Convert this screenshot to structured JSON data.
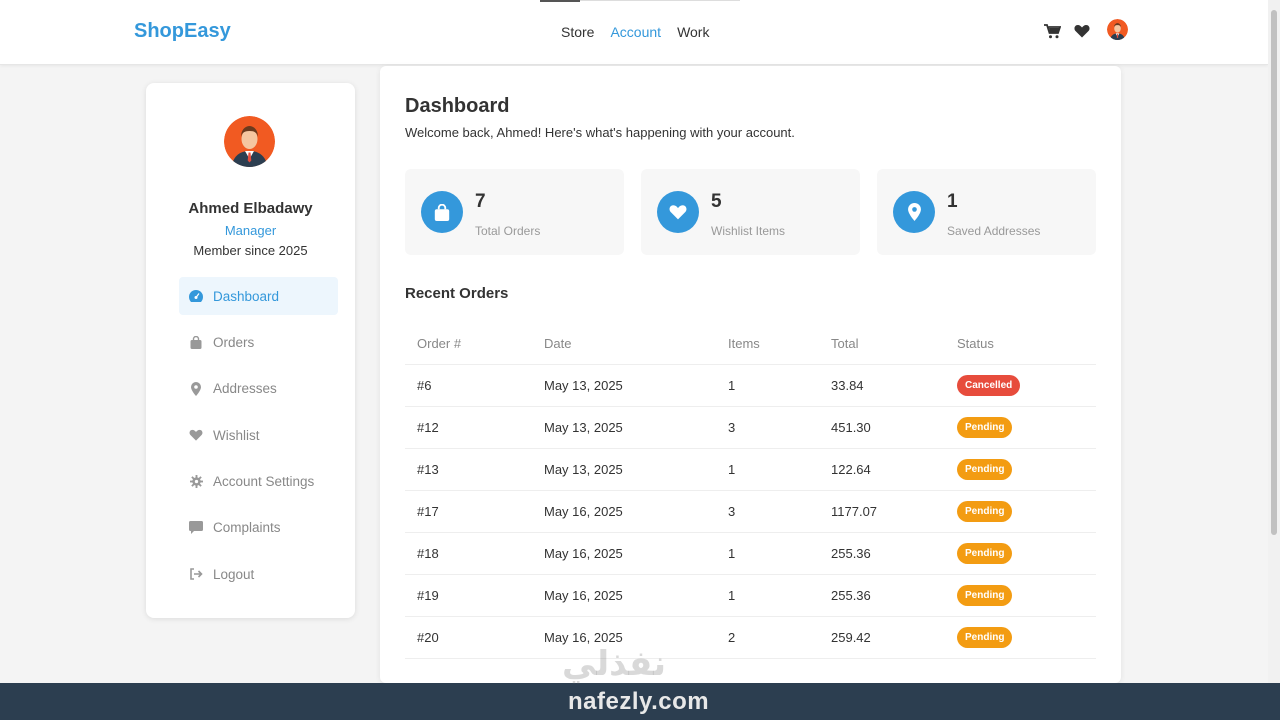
{
  "app": {
    "brand": "ShopEasy"
  },
  "nav": {
    "links": [
      {
        "label": "Store",
        "active": false
      },
      {
        "label": "Account",
        "active": true
      },
      {
        "label": "Work",
        "active": false
      }
    ],
    "icons": [
      "cart-icon",
      "heart-icon",
      "user-avatar"
    ]
  },
  "profile": {
    "name": "Ahmed Elbadawy",
    "role": "Manager",
    "since": "Member since 2025"
  },
  "menu": [
    {
      "label": "Dashboard",
      "icon": "gauge-icon",
      "active": true
    },
    {
      "label": "Orders",
      "icon": "bag-icon",
      "active": false
    },
    {
      "label": "Addresses",
      "icon": "map-pin-icon",
      "active": false
    },
    {
      "label": "Wishlist",
      "icon": "heart-icon",
      "active": false
    },
    {
      "label": "Account Settings",
      "icon": "gear-icon",
      "active": false
    },
    {
      "label": "Complaints",
      "icon": "comment-icon",
      "active": false
    },
    {
      "label": "Logout",
      "icon": "logout-icon",
      "active": false
    }
  ],
  "dashboard": {
    "title": "Dashboard",
    "welcome": "Welcome back, Ahmed! Here's what's happening with your account.",
    "stats": [
      {
        "value": "7",
        "label": "Total Orders",
        "icon": "bag-icon"
      },
      {
        "value": "5",
        "label": "Wishlist Items",
        "icon": "heart-icon"
      },
      {
        "value": "1",
        "label": "Saved Addresses",
        "icon": "map-pin-icon"
      }
    ],
    "recent_orders_title": "Recent Orders",
    "columns": [
      "Order #",
      "Date",
      "Items",
      "Total",
      "Status"
    ],
    "orders": [
      {
        "id": "#6",
        "date": "May 13, 2025",
        "items": "1",
        "total": "33.84",
        "status": "Cancelled"
      },
      {
        "id": "#12",
        "date": "May 13, 2025",
        "items": "3",
        "total": "451.30",
        "status": "Pending"
      },
      {
        "id": "#13",
        "date": "May 13, 2025",
        "items": "1",
        "total": "122.64",
        "status": "Pending"
      },
      {
        "id": "#17",
        "date": "May 16, 2025",
        "items": "3",
        "total": "1177.07",
        "status": "Pending"
      },
      {
        "id": "#18",
        "date": "May 16, 2025",
        "items": "1",
        "total": "255.36",
        "status": "Pending"
      },
      {
        "id": "#19",
        "date": "May 16, 2025",
        "items": "1",
        "total": "255.36",
        "status": "Pending"
      },
      {
        "id": "#20",
        "date": "May 16, 2025",
        "items": "2",
        "total": "259.42",
        "status": "Pending"
      }
    ]
  },
  "watermark": {
    "arabic": "نفذلي",
    "latin": "nafezly.com"
  },
  "colors": {
    "accent": "#3498db",
    "cancelled": "#e74c3c",
    "pending": "#f39c12",
    "footer": "#2c3e50"
  }
}
